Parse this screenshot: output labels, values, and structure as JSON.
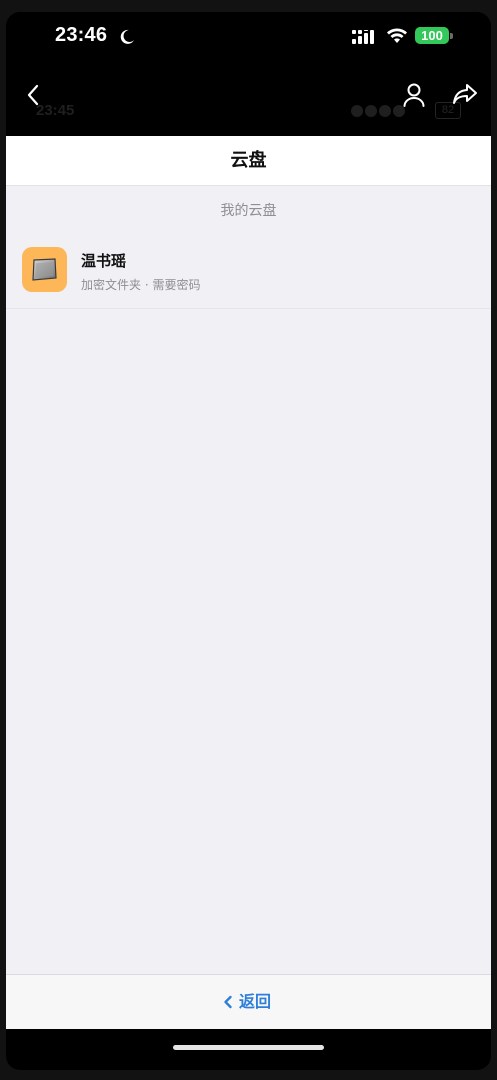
{
  "status_bar": {
    "time": "23:46",
    "battery": "100"
  },
  "nav": {
    "ghost_time": "23:45",
    "ghost_battery": "82"
  },
  "page": {
    "title": "云盘",
    "section_label": "我的云盘",
    "folders": [
      {
        "name": "温书瑶",
        "subtitle": "加密文件夹 · 需要密码",
        "icon": "folder-icon"
      }
    ],
    "back_label": "返回"
  },
  "colors": {
    "accent": "#2f7fd8",
    "folder_bg": "#fdb758",
    "battery": "#34c759",
    "page_bg": "#f1f0f5"
  }
}
